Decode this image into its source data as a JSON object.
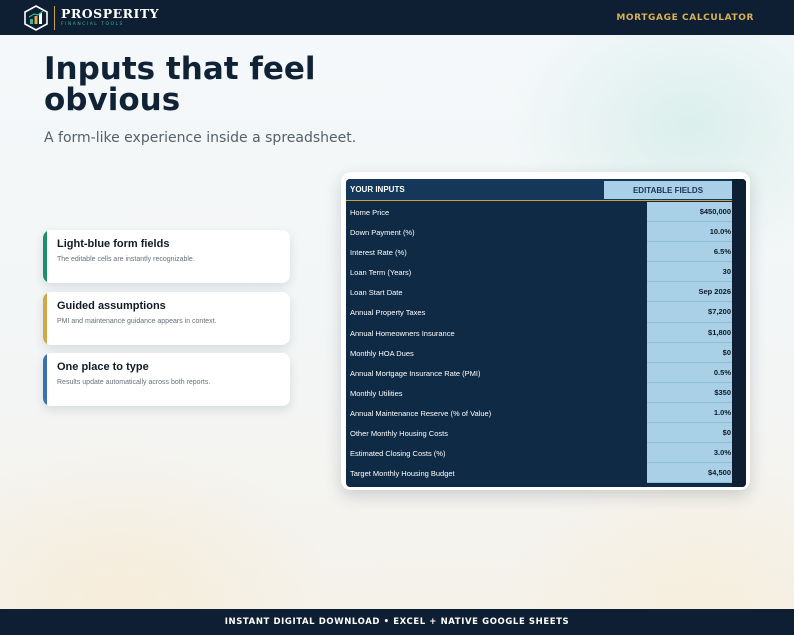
{
  "header": {
    "brand_name": "PROSPERITY",
    "brand_sub": "FINANCIAL TOOLS",
    "nav_label": "MORTGAGE CALCULATOR"
  },
  "hero": {
    "title": "Inputs that feel obvious",
    "subtitle": "A form-like experience inside a spreadsheet."
  },
  "features": [
    {
      "title": "Light-blue form fields",
      "desc": "The editable cells are instantly recognizable.",
      "accent": "#1f8f6a"
    },
    {
      "title": "Guided assumptions",
      "desc": "PMI and maintenance guidance appears in context.",
      "accent": "#d4a64a"
    },
    {
      "title": "One place to type",
      "desc": "Results update automatically across both reports.",
      "accent": "#3a72b0"
    }
  ],
  "sheet": {
    "header_left": "YOUR INPUTS",
    "header_right": "EDITABLE FIELDS",
    "rows": [
      {
        "label": "Home Price",
        "value": "$450,000"
      },
      {
        "label": "Down Payment (%)",
        "value": "10.0%"
      },
      {
        "label": "Interest Rate (%)",
        "value": "6.5%"
      },
      {
        "label": "Loan Term (Years)",
        "value": "30"
      },
      {
        "label": "Loan Start Date",
        "value": "Sep 2026"
      },
      {
        "label": "Annual Property Taxes",
        "value": "$7,200"
      },
      {
        "label": "Annual Homeowners Insurance",
        "value": "$1,800"
      },
      {
        "label": "Monthly HOA Dues",
        "value": "$0"
      },
      {
        "label": "Annual Mortgage Insurance Rate (PMI)",
        "value": "0.5%"
      },
      {
        "label": "Monthly Utilities",
        "value": "$350"
      },
      {
        "label": "Annual Maintenance Reserve (% of Value)",
        "value": "1.0%"
      },
      {
        "label": "Other Monthly Housing Costs",
        "value": "$0"
      },
      {
        "label": "Estimated Closing Costs (%)",
        "value": "3.0%"
      },
      {
        "label": "Target Monthly Housing Budget",
        "value": "$4,500"
      }
    ]
  },
  "footer": {
    "text": "INSTANT DIGITAL DOWNLOAD • EXCEL + NATIVE GOOGLE SHEETS"
  },
  "colors": {
    "navy": "#0e1f33",
    "gold": "#d8b055",
    "field_blue": "#a9d0e6"
  },
  "icons": {
    "logo": "hexagon-bar-chart-icon"
  }
}
